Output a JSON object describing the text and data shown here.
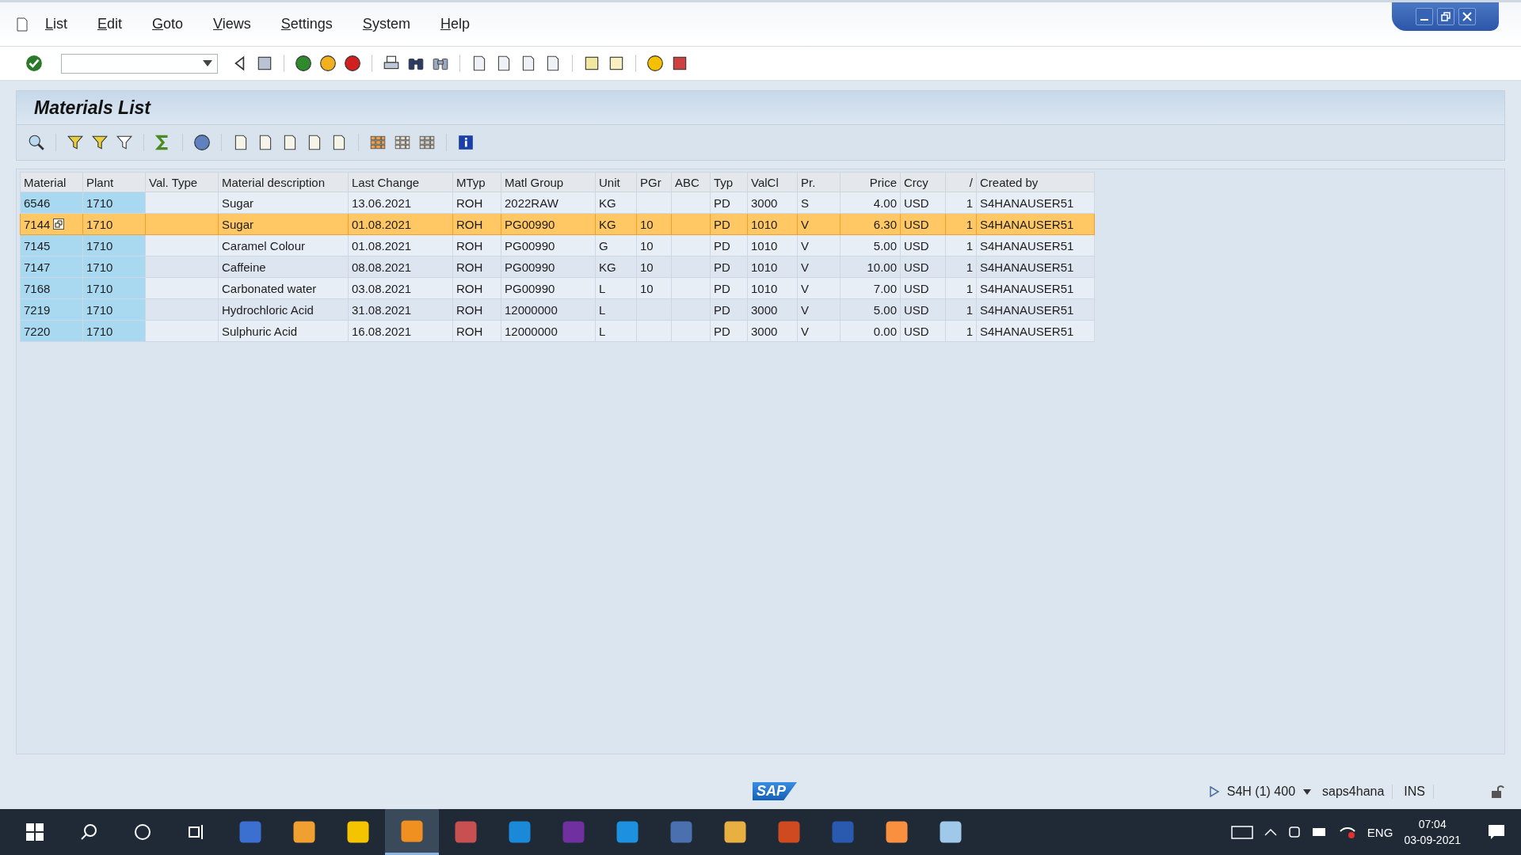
{
  "menu": [
    "List",
    "Edit",
    "Goto",
    "Views",
    "Settings",
    "System",
    "Help"
  ],
  "screen_title": "Materials List",
  "table": {
    "columns": [
      {
        "label": "Material",
        "kind": "key"
      },
      {
        "label": "Plant",
        "kind": "key"
      },
      {
        "label": "Val. Type",
        "kind": "text"
      },
      {
        "label": "Material description",
        "kind": "text"
      },
      {
        "label": "Last Change",
        "kind": "text"
      },
      {
        "label": "MTyp",
        "kind": "text"
      },
      {
        "label": "Matl Group",
        "kind": "text"
      },
      {
        "label": "Unit",
        "kind": "text"
      },
      {
        "label": "PGr",
        "kind": "text"
      },
      {
        "label": "ABC",
        "kind": "text"
      },
      {
        "label": "Typ",
        "kind": "text"
      },
      {
        "label": "ValCl",
        "kind": "text"
      },
      {
        "label": "Pr.",
        "kind": "text"
      },
      {
        "label": "Price",
        "kind": "number"
      },
      {
        "label": "Crcy",
        "kind": "text"
      },
      {
        "label": "/",
        "kind": "number"
      },
      {
        "label": "Created by",
        "kind": "text"
      }
    ],
    "rows": [
      {
        "selected": false,
        "cells": [
          "6546",
          "1710",
          "",
          "Sugar",
          "13.06.2021",
          "ROH",
          "2022RAW",
          "KG",
          "",
          "",
          "PD",
          "3000",
          "S",
          "4.00",
          "USD",
          "1",
          "S4HANAUSER51"
        ]
      },
      {
        "selected": true,
        "cells": [
          "7144",
          "1710",
          "",
          "Sugar",
          "01.08.2021",
          "ROH",
          "PG00990",
          "KG",
          "10",
          "",
          "PD",
          "1010",
          "V",
          "6.30",
          "USD",
          "1",
          "S4HANAUSER51"
        ]
      },
      {
        "selected": false,
        "cells": [
          "7145",
          "1710",
          "",
          "Caramel Colour",
          "01.08.2021",
          "ROH",
          "PG00990",
          "G",
          "10",
          "",
          "PD",
          "1010",
          "V",
          "5.00",
          "USD",
          "1",
          "S4HANAUSER51"
        ]
      },
      {
        "selected": false,
        "cells": [
          "7147",
          "1710",
          "",
          "Caffeine",
          "08.08.2021",
          "ROH",
          "PG00990",
          "KG",
          "10",
          "",
          "PD",
          "1010",
          "V",
          "10.00",
          "USD",
          "1",
          "S4HANAUSER51"
        ]
      },
      {
        "selected": false,
        "cells": [
          "7168",
          "1710",
          "",
          "Carbonated water",
          "03.08.2021",
          "ROH",
          "PG00990",
          "L",
          "10",
          "",
          "PD",
          "1010",
          "V",
          "7.00",
          "USD",
          "1",
          "S4HANAUSER51"
        ]
      },
      {
        "selected": false,
        "cells": [
          "7219",
          "1710",
          "",
          "Hydrochloric Acid",
          "31.08.2021",
          "ROH",
          "12000000",
          "L",
          "",
          "",
          "PD",
          "3000",
          "V",
          "5.00",
          "USD",
          "1",
          "S4HANAUSER51"
        ]
      },
      {
        "selected": false,
        "cells": [
          "7220",
          "1710",
          "",
          "Sulphuric Acid",
          "16.08.2021",
          "ROH",
          "12000000",
          "L",
          "",
          "",
          "PD",
          "3000",
          "V",
          "0.00",
          "USD",
          "1",
          "S4HANAUSER51"
        ]
      }
    ]
  },
  "status_bar": {
    "logo": "SAP",
    "system": "S4H (1) 400",
    "server": "saps4hana",
    "mode": "INS"
  },
  "taskbar": {
    "language": "ENG",
    "time": "07:04",
    "date": "03-09-2021"
  }
}
